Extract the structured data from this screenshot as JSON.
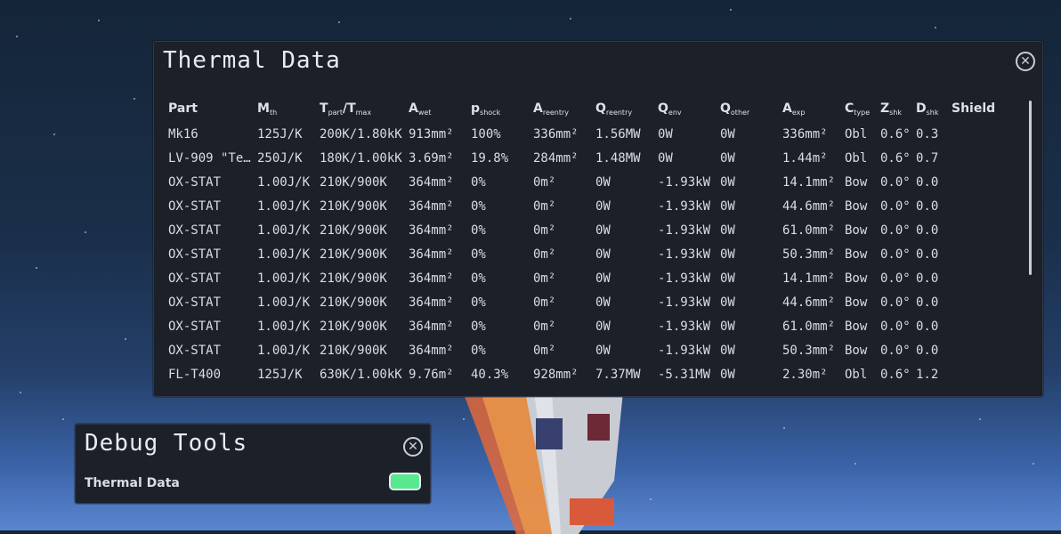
{
  "thermal_window": {
    "title": "Thermal Data",
    "headers": [
      {
        "main": "Part",
        "sub": ""
      },
      {
        "main": "M",
        "sub": "th"
      },
      {
        "main": "T",
        "sub": "part",
        "main2": "/T",
        "sub2": "max"
      },
      {
        "main": "A",
        "sub": "wet"
      },
      {
        "main": "p",
        "sub": "shock"
      },
      {
        "main": "A",
        "sub": "reentry"
      },
      {
        "main": "Q",
        "sub": "reentry"
      },
      {
        "main": "Q",
        "sub": "env"
      },
      {
        "main": "Q",
        "sub": "other"
      },
      {
        "main": "A",
        "sub": "exp"
      },
      {
        "main": "C",
        "sub": "type"
      },
      {
        "main": "Z",
        "sub": "shk"
      },
      {
        "main": "D",
        "sub": "shk"
      },
      {
        "main": "Shield",
        "sub": ""
      }
    ],
    "rows": [
      [
        "Mk16",
        "125J/K",
        "200K/1.80kK",
        "913mm²",
        "100%",
        "336mm²",
        "1.56MW",
        "0W",
        "0W",
        "336mm²",
        "Obl",
        "0.6°",
        "0.3",
        ""
      ],
      [
        "LV-909 \"Te…",
        "250J/K",
        "180K/1.00kK",
        "3.69m²",
        "19.8%",
        "284mm²",
        "1.48MW",
        "0W",
        "0W",
        "1.44m²",
        "Obl",
        "0.6°",
        "0.7",
        ""
      ],
      [
        "OX-STAT",
        "1.00J/K",
        "210K/900K",
        "364mm²",
        "0%",
        "0m²",
        "0W",
        "-1.93kW",
        "0W",
        "14.1mm²",
        "Bow",
        "0.0°",
        "0.0",
        ""
      ],
      [
        "OX-STAT",
        "1.00J/K",
        "210K/900K",
        "364mm²",
        "0%",
        "0m²",
        "0W",
        "-1.93kW",
        "0W",
        "44.6mm²",
        "Bow",
        "0.0°",
        "0.0",
        ""
      ],
      [
        "OX-STAT",
        "1.00J/K",
        "210K/900K",
        "364mm²",
        "0%",
        "0m²",
        "0W",
        "-1.93kW",
        "0W",
        "61.0mm²",
        "Bow",
        "0.0°",
        "0.0",
        ""
      ],
      [
        "OX-STAT",
        "1.00J/K",
        "210K/900K",
        "364mm²",
        "0%",
        "0m²",
        "0W",
        "-1.93kW",
        "0W",
        "50.3mm²",
        "Bow",
        "0.0°",
        "0.0",
        ""
      ],
      [
        "OX-STAT",
        "1.00J/K",
        "210K/900K",
        "364mm²",
        "0%",
        "0m²",
        "0W",
        "-1.93kW",
        "0W",
        "14.1mm²",
        "Bow",
        "0.0°",
        "0.0",
        ""
      ],
      [
        "OX-STAT",
        "1.00J/K",
        "210K/900K",
        "364mm²",
        "0%",
        "0m²",
        "0W",
        "-1.93kW",
        "0W",
        "44.6mm²",
        "Bow",
        "0.0°",
        "0.0",
        ""
      ],
      [
        "OX-STAT",
        "1.00J/K",
        "210K/900K",
        "364mm²",
        "0%",
        "0m²",
        "0W",
        "-1.93kW",
        "0W",
        "61.0mm²",
        "Bow",
        "0.0°",
        "0.0",
        ""
      ],
      [
        "OX-STAT",
        "1.00J/K",
        "210K/900K",
        "364mm²",
        "0%",
        "0m²",
        "0W",
        "-1.93kW",
        "0W",
        "50.3mm²",
        "Bow",
        "0.0°",
        "0.0",
        ""
      ],
      [
        "FL-T400",
        "125J/K",
        "630K/1.00kK",
        "9.76m²",
        "40.3%",
        "928mm²",
        "7.37MW",
        "-5.31MW",
        "0W",
        "2.30m²",
        "Obl",
        "0.6°",
        "1.2",
        ""
      ]
    ],
    "close_icon": "close-icon"
  },
  "debug_window": {
    "title": "Debug Tools",
    "toggle_label": "Thermal Data",
    "toggle_on": true,
    "toggle_color": "#58e88e",
    "close_icon": "close-icon"
  }
}
